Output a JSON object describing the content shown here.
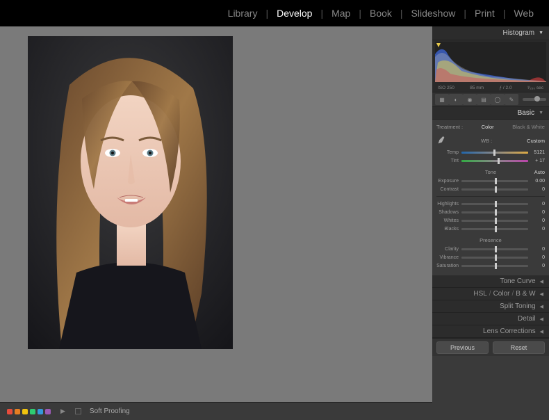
{
  "nav": {
    "tabs": [
      "Library",
      "Develop",
      "Map",
      "Book",
      "Slideshow",
      "Print",
      "Web"
    ],
    "active": "Develop"
  },
  "panel": {
    "histogram_title": "Histogram",
    "meta": {
      "iso": "ISO 250",
      "focal": "85 mm",
      "aperture": "ƒ / 2.0",
      "shutter": "¹⁄₂₅₀ sec"
    }
  },
  "basic": {
    "title": "Basic",
    "treatment_label": "Treatment :",
    "treatment_color": "Color",
    "treatment_bw": "Black & White",
    "wb_label": "WB :",
    "wb_value": "Custom",
    "temp_label": "Temp",
    "temp_value": "5121",
    "tint_label": "Tint",
    "tint_value": "+ 17",
    "tone_label": "Tone",
    "auto_label": "Auto",
    "exposure_label": "Exposure",
    "exposure_value": "0.00",
    "contrast_label": "Contrast",
    "contrast_value": "0",
    "highlights_label": "Highlights",
    "highlights_value": "0",
    "shadows_label": "Shadows",
    "shadows_value": "0",
    "whites_label": "Whites",
    "whites_value": "0",
    "blacks_label": "Blacks",
    "blacks_value": "0",
    "presence_label": "Presence",
    "clarity_label": "Clarity",
    "clarity_value": "0",
    "vibrance_label": "Vibrance",
    "vibrance_value": "0",
    "saturation_label": "Saturation",
    "saturation_value": "0"
  },
  "sections": {
    "tone_curve": "Tone Curve",
    "hsl": "HSL",
    "hsl_color": "Color",
    "hsl_bw": "B & W",
    "split_toning": "Split Toning",
    "detail": "Detail",
    "lens": "Lens Corrections"
  },
  "bottom": {
    "soft_proofing": "Soft Proofing",
    "previous": "Previous",
    "reset": "Reset"
  },
  "colors": {
    "dots": [
      "#e74c3c",
      "#e67e22",
      "#f1c40f",
      "#2ecc71",
      "#3498db",
      "#9b59b6"
    ]
  }
}
